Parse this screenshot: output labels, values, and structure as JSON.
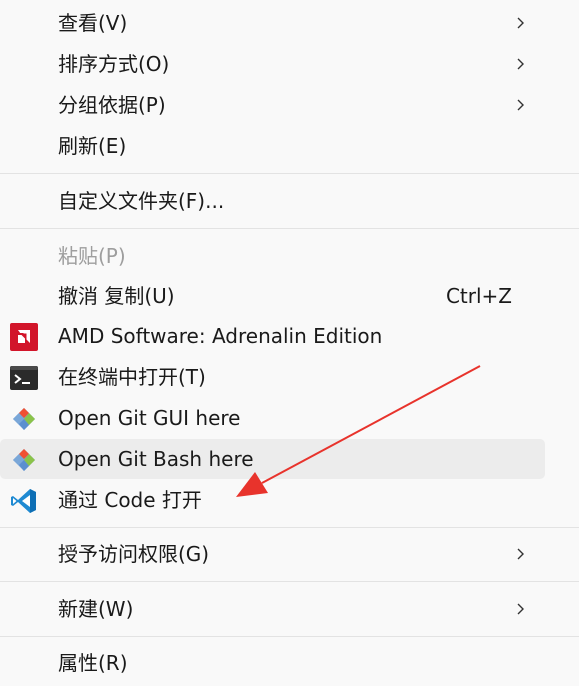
{
  "menu": {
    "view": {
      "label": "查看(V)"
    },
    "sort_by": {
      "label": "排序方式(O)"
    },
    "group_by": {
      "label": "分组依据(P)"
    },
    "refresh": {
      "label": "刷新(E)"
    },
    "customize_folder": {
      "label": "自定义文件夹(F)..."
    },
    "paste": {
      "label": "粘贴(P)"
    },
    "undo_copy": {
      "label": "撤消 复制(U)",
      "shortcut": "Ctrl+Z"
    },
    "amd_software": {
      "label": "AMD Software: Adrenalin Edition",
      "icon": "amd-logo-icon"
    },
    "open_terminal": {
      "label": "在终端中打开(T)",
      "icon": "terminal-icon"
    },
    "git_gui": {
      "label": "Open Git GUI here",
      "icon": "git-icon"
    },
    "git_bash": {
      "label": "Open Git Bash here",
      "icon": "git-icon"
    },
    "open_with_code": {
      "label": "通过 Code 打开",
      "icon": "vscode-icon"
    },
    "give_access": {
      "label": "授予访问权限(G)"
    },
    "new": {
      "label": "新建(W)"
    },
    "properties": {
      "label": "属性(R)"
    }
  },
  "colors": {
    "amd_red": "#d2152a",
    "vscode_blue": "#1f8ad2",
    "git_orange": "#f05032",
    "annotation_arrow": "#e8332c",
    "hover_bg": "#ececec"
  }
}
